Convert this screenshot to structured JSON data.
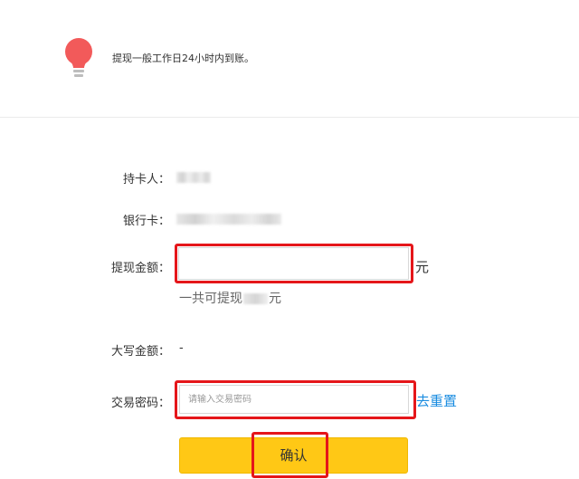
{
  "notice": {
    "icon": "lightbulb-icon",
    "icon_color": "#f25a5a",
    "text": "提现一般工作日24小时内到账。"
  },
  "form": {
    "cardholder": {
      "label": "持卡人："
    },
    "bank_card": {
      "label": "银行卡："
    },
    "withdraw_amount": {
      "label": "提现金额：",
      "value": "",
      "unit": "元"
    },
    "available": {
      "prefix": "一共可提现",
      "suffix": "元"
    },
    "uppercase_amount": {
      "label": "大写金额：",
      "value": "-"
    },
    "trade_password": {
      "label": "交易密码：",
      "placeholder": "请输入交易密码",
      "reset_label": "去重置"
    },
    "confirm_label": "确认"
  },
  "colors": {
    "accent_button": "#ffc815",
    "link": "#1a8ce0",
    "highlight_frame": "#e5161a"
  }
}
